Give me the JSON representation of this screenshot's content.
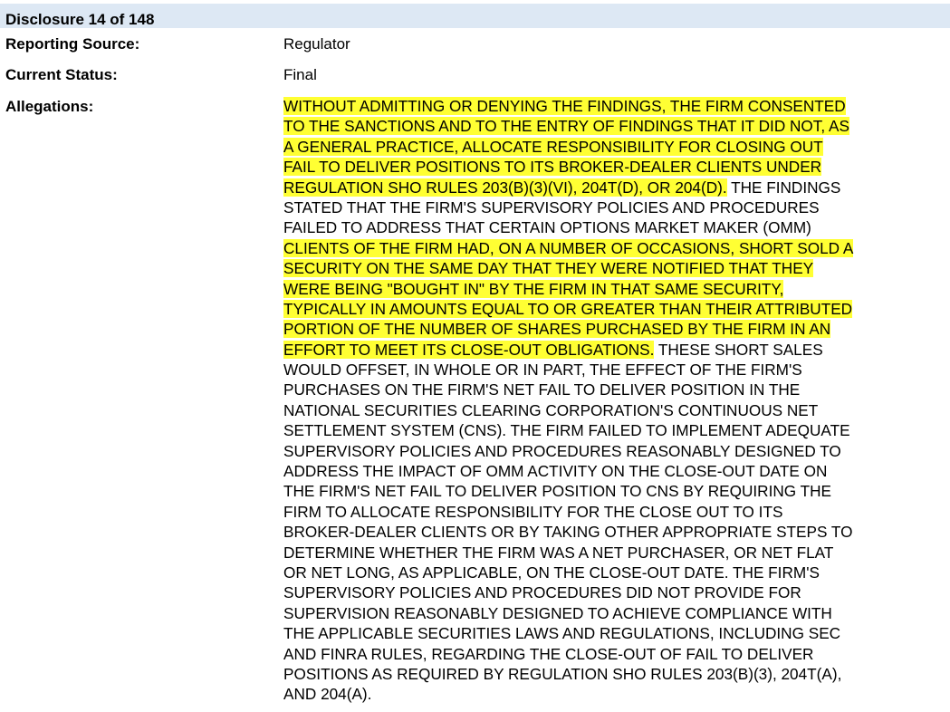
{
  "header": {
    "title": "Disclosure 14 of 148",
    "background_color": "#dde8f4"
  },
  "fields": {
    "reporting_source": {
      "label": "Reporting Source:",
      "value": "Regulator"
    },
    "current_status": {
      "label": "Current Status:",
      "value": "Final"
    },
    "allegations": {
      "label": "Allegations:"
    }
  },
  "highlight_color": "#ffff33",
  "allegations_lines": [
    [
      {
        "text": "WITHOUT ADMITTING OR DENYING THE FINDINGS, THE FIRM CONSENTED",
        "hl": true
      }
    ],
    [
      {
        "text": "TO THE SANCTIONS AND TO THE ENTRY OF FINDINGS THAT IT DID NOT, AS",
        "hl": true
      }
    ],
    [
      {
        "text": "A GENERAL PRACTICE, ALLOCATE RESPONSIBILITY FOR CLOSING OUT",
        "hl": true
      }
    ],
    [
      {
        "text": "FAIL TO DELIVER POSITIONS TO ITS BROKER-DEALER CLIENTS UNDER",
        "hl": true
      }
    ],
    [
      {
        "text": "REGULATION SHO RULES 203(B)(3)(VI), 204T(D), OR 204(D).",
        "hl": true
      },
      {
        "text": " THE FINDINGS",
        "hl": false
      }
    ],
    [
      {
        "text": "STATED THAT THE FIRM'S SUPERVISORY POLICIES AND PROCEDURES",
        "hl": false
      }
    ],
    [
      {
        "text": "FAILED TO ADDRESS THAT CERTAIN OPTIONS MARKET MAKER (OMM)",
        "hl": false
      }
    ],
    [
      {
        "text": "CLIENTS OF THE FIRM HAD, ON A NUMBER OF OCCASIONS, SHORT SOLD A",
        "hl": true
      }
    ],
    [
      {
        "text": "SECURITY ON THE SAME DAY THAT THEY WERE NOTIFIED THAT THEY",
        "hl": true
      }
    ],
    [
      {
        "text": "WERE BEING \"BOUGHT IN\" BY THE FIRM IN THAT SAME SECURITY,",
        "hl": true
      }
    ],
    [
      {
        "text": "TYPICALLY IN AMOUNTS EQUAL TO OR GREATER THAN THEIR ATTRIBUTED",
        "hl": true
      }
    ],
    [
      {
        "text": "PORTION OF THE NUMBER OF SHARES PURCHASED BY THE FIRM IN AN",
        "hl": true
      }
    ],
    [
      {
        "text": "EFFORT TO MEET ITS CLOSE-OUT OBLIGATIONS.",
        "hl": true
      },
      {
        "text": " THESE SHORT SALES",
        "hl": false
      }
    ],
    [
      {
        "text": "WOULD OFFSET, IN WHOLE OR IN PART, THE EFFECT OF THE FIRM'S",
        "hl": false
      }
    ],
    [
      {
        "text": "PURCHASES ON THE FIRM'S NET FAIL TO DELIVER POSITION IN THE",
        "hl": false
      }
    ],
    [
      {
        "text": "NATIONAL SECURITIES CLEARING CORPORATION'S CONTINUOUS NET",
        "hl": false
      }
    ],
    [
      {
        "text": "SETTLEMENT SYSTEM (CNS). THE FIRM FAILED TO IMPLEMENT ADEQUATE",
        "hl": false
      }
    ],
    [
      {
        "text": "SUPERVISORY POLICIES AND PROCEDURES REASONABLY DESIGNED TO",
        "hl": false
      }
    ],
    [
      {
        "text": "ADDRESS THE IMPACT OF OMM ACTIVITY ON THE CLOSE-OUT DATE ON",
        "hl": false
      }
    ],
    [
      {
        "text": "THE FIRM'S NET FAIL TO DELIVER POSITION TO CNS BY REQUIRING THE",
        "hl": false
      }
    ],
    [
      {
        "text": "FIRM TO ALLOCATE RESPONSIBILITY FOR THE CLOSE OUT TO ITS",
        "hl": false
      }
    ],
    [
      {
        "text": "BROKER-DEALER CLIENTS OR BY TAKING OTHER APPROPRIATE STEPS TO",
        "hl": false
      }
    ],
    [
      {
        "text": "DETERMINE WHETHER THE FIRM WAS A NET PURCHASER, OR NET FLAT",
        "hl": false
      }
    ],
    [
      {
        "text": "OR NET LONG, AS APPLICABLE, ON THE CLOSE-OUT DATE. THE FIRM'S",
        "hl": false
      }
    ],
    [
      {
        "text": "SUPERVISORY POLICIES AND PROCEDURES DID NOT PROVIDE FOR",
        "hl": false
      }
    ],
    [
      {
        "text": "SUPERVISION REASONABLY DESIGNED TO ACHIEVE COMPLIANCE WITH",
        "hl": false
      }
    ],
    [
      {
        "text": "THE APPLICABLE SECURITIES LAWS AND REGULATIONS, INCLUDING SEC",
        "hl": false
      }
    ],
    [
      {
        "text": "AND FINRA RULES, REGARDING THE CLOSE-OUT OF FAIL TO DELIVER",
        "hl": false
      }
    ],
    [
      {
        "text": "POSITIONS AS REQUIRED BY REGULATION SHO RULES 203(B)(3), 204T(A),",
        "hl": false
      }
    ],
    [
      {
        "text": "AND 204(A).",
        "hl": false
      }
    ]
  ]
}
